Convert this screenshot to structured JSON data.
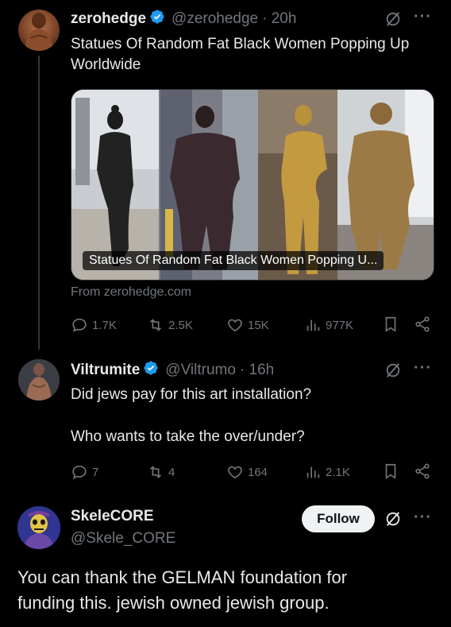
{
  "tweet1": {
    "name": "zerohedge",
    "handle": "@zerohedge",
    "time": "· 20h",
    "text_line1": "Statues Of Random Fat Black Women Popping Up",
    "text_line2": "Worldwide",
    "card_caption": "Statues Of Random Fat Black Women Popping U...",
    "card_source": "From zerohedge.com",
    "replies": "1.7K",
    "reposts": "2.5K",
    "likes": "15K",
    "views": "977K"
  },
  "tweet2": {
    "name": "Viltrumite",
    "handle": "@Viltrumo",
    "time": "· 16h",
    "text_line1": "Did jews pay for this art installation?",
    "text_line2": "Who wants to take the over/under?",
    "replies": "7",
    "reposts": "4",
    "likes": "164",
    "views": "2.1K"
  },
  "tweet3": {
    "name": "SkeleCORE",
    "handle": "@Skele_CORE",
    "follow_label": "Follow",
    "text_line1": "You can thank the GELMAN foundation for",
    "text_line2": "funding this. jewish owned jewish group."
  },
  "icons": {
    "verified": "verified-badge-icon",
    "grok": "grok-icon",
    "more": "more-icon",
    "reply": "reply-icon",
    "repost": "repost-icon",
    "like": "like-icon",
    "views": "views-icon",
    "bookmark": "bookmark-icon",
    "share": "share-icon"
  },
  "colors": {
    "background": "#000000",
    "text": "#e7e9ea",
    "secondary": "#71767b",
    "verified": "#1d9bf0",
    "follow_bg": "#eff3f4"
  }
}
